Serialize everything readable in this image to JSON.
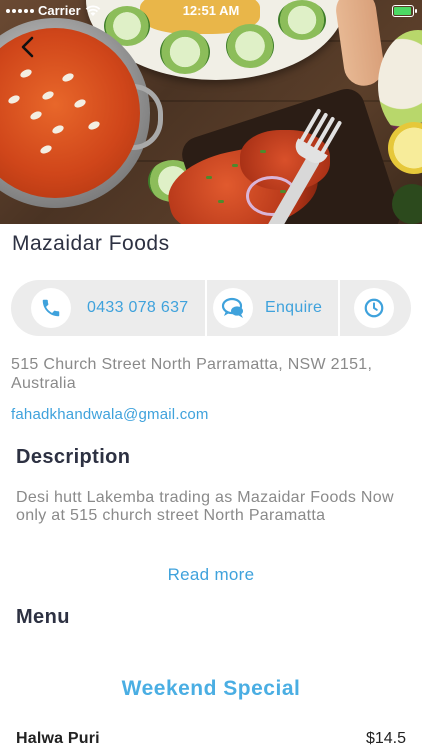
{
  "status_bar": {
    "carrier": "Carrier",
    "time": "12:51 AM"
  },
  "hero": {
    "description_icons": [
      "back-chevron-icon"
    ]
  },
  "business": {
    "name": "Mazaidar Foods"
  },
  "actions": {
    "phone": {
      "label": "0433 078 637",
      "icon": "phone-icon"
    },
    "enquire": {
      "label": "Enquire",
      "icon": "chat-bubble-icon"
    },
    "hours": {
      "icon": "clock-icon"
    }
  },
  "contact": {
    "address": "515 Church Street North Parramatta, NSW 2151, Australia",
    "email": "fahadkhandwala@gmail.com"
  },
  "description": {
    "heading": "Description",
    "text": "Desi hutt Lakemba trading as Mazaidar Foods Now only at 515 church street North Paramatta",
    "read_more": "Read more"
  },
  "menu": {
    "heading": "Menu",
    "categories": [
      {
        "name": "Weekend Special",
        "items": [
          {
            "name": "Halwa Puri",
            "price": "$14.5"
          }
        ]
      }
    ]
  },
  "colors": {
    "accent": "#3fa2dc",
    "category": "#4aaee3",
    "heading": "#2d3142",
    "muted": "#8a8a8a",
    "action_bar": "#ececec"
  }
}
